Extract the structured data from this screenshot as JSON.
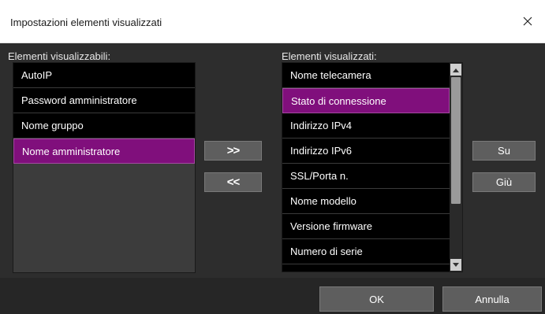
{
  "window": {
    "title": "Impostazioni elementi visualizzati"
  },
  "available": {
    "label": "Elementi visualizzabili:",
    "items": [
      "AutoIP",
      "Password amministratore",
      "Nome gruppo",
      "Nome amministratore"
    ],
    "selected": "Nome amministratore"
  },
  "displayed": {
    "label": "Elementi visualizzati:",
    "items": [
      "Nome telecamera",
      "Stato di connessione",
      "Indirizzo IPv4",
      "Indirizzo IPv6",
      "SSL/Porta n.",
      "Nome modello",
      "Versione firmware",
      "Numero di serie"
    ],
    "selected": "Stato di connessione"
  },
  "buttons": {
    "add": ">>",
    "remove": "<<",
    "up": "Su",
    "down": "Giù",
    "ok": "OK",
    "cancel": "Annulla"
  },
  "colors": {
    "selection": "#800f7c",
    "background": "#2d2d2d"
  },
  "icons": {
    "close": "close-icon",
    "scroll_up": "scroll-up-arrow-icon",
    "scroll_down": "scroll-down-arrow-icon"
  }
}
